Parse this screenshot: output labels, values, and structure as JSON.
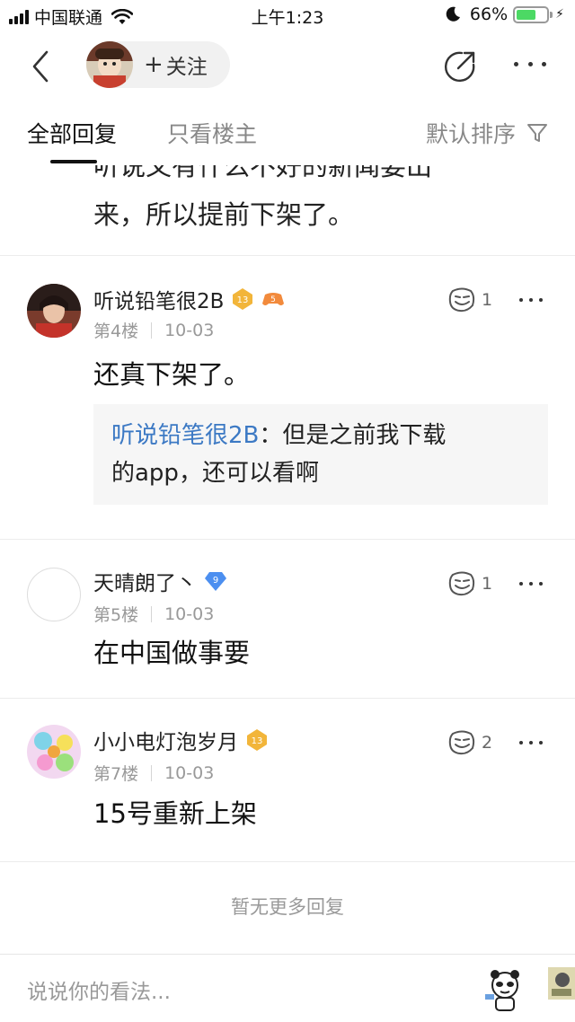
{
  "status_bar": {
    "carrier": "中国联通",
    "time": "上午1:23",
    "battery": "66%",
    "battery_level": 0.66
  },
  "nav": {
    "follow_label": "关注",
    "follow_plus": "+"
  },
  "tabs": {
    "all": "全部回复",
    "op_only": "只看楼主",
    "sort": "默认排序"
  },
  "partial_post": {
    "line1": "听说又有什么不好的新闻要出",
    "line2": "来，所以提前下架了。"
  },
  "posts": [
    {
      "username": "听说铅笔很2B",
      "level": "13",
      "badge2": "5",
      "floor": "第4楼",
      "date": "10-03",
      "likes": "1",
      "text": "还真下架了。",
      "quote_name": "听说铅笔很2B",
      "quote_sep": "：",
      "quote_text_1": "但是之前我下载",
      "quote_text_2": "的app，还可以看啊"
    },
    {
      "username": "天晴朗了丶",
      "level": "9",
      "floor": "第5楼",
      "date": "10-03",
      "likes": "1",
      "text": "在中国做事要"
    },
    {
      "username": "小小电灯泡岁月",
      "level": "13",
      "floor": "第7楼",
      "date": "10-03",
      "likes": "2",
      "text": "15号重新上架"
    }
  ],
  "footer": {
    "no_more": "暂无更多回复",
    "input_placeholder": "说说你的看法..."
  },
  "colors": {
    "quote_name": "#3c79c4",
    "gold_badge": "#f2b53a",
    "blue_badge": "#4c8ff0",
    "battery_fill": "#4cd964"
  }
}
